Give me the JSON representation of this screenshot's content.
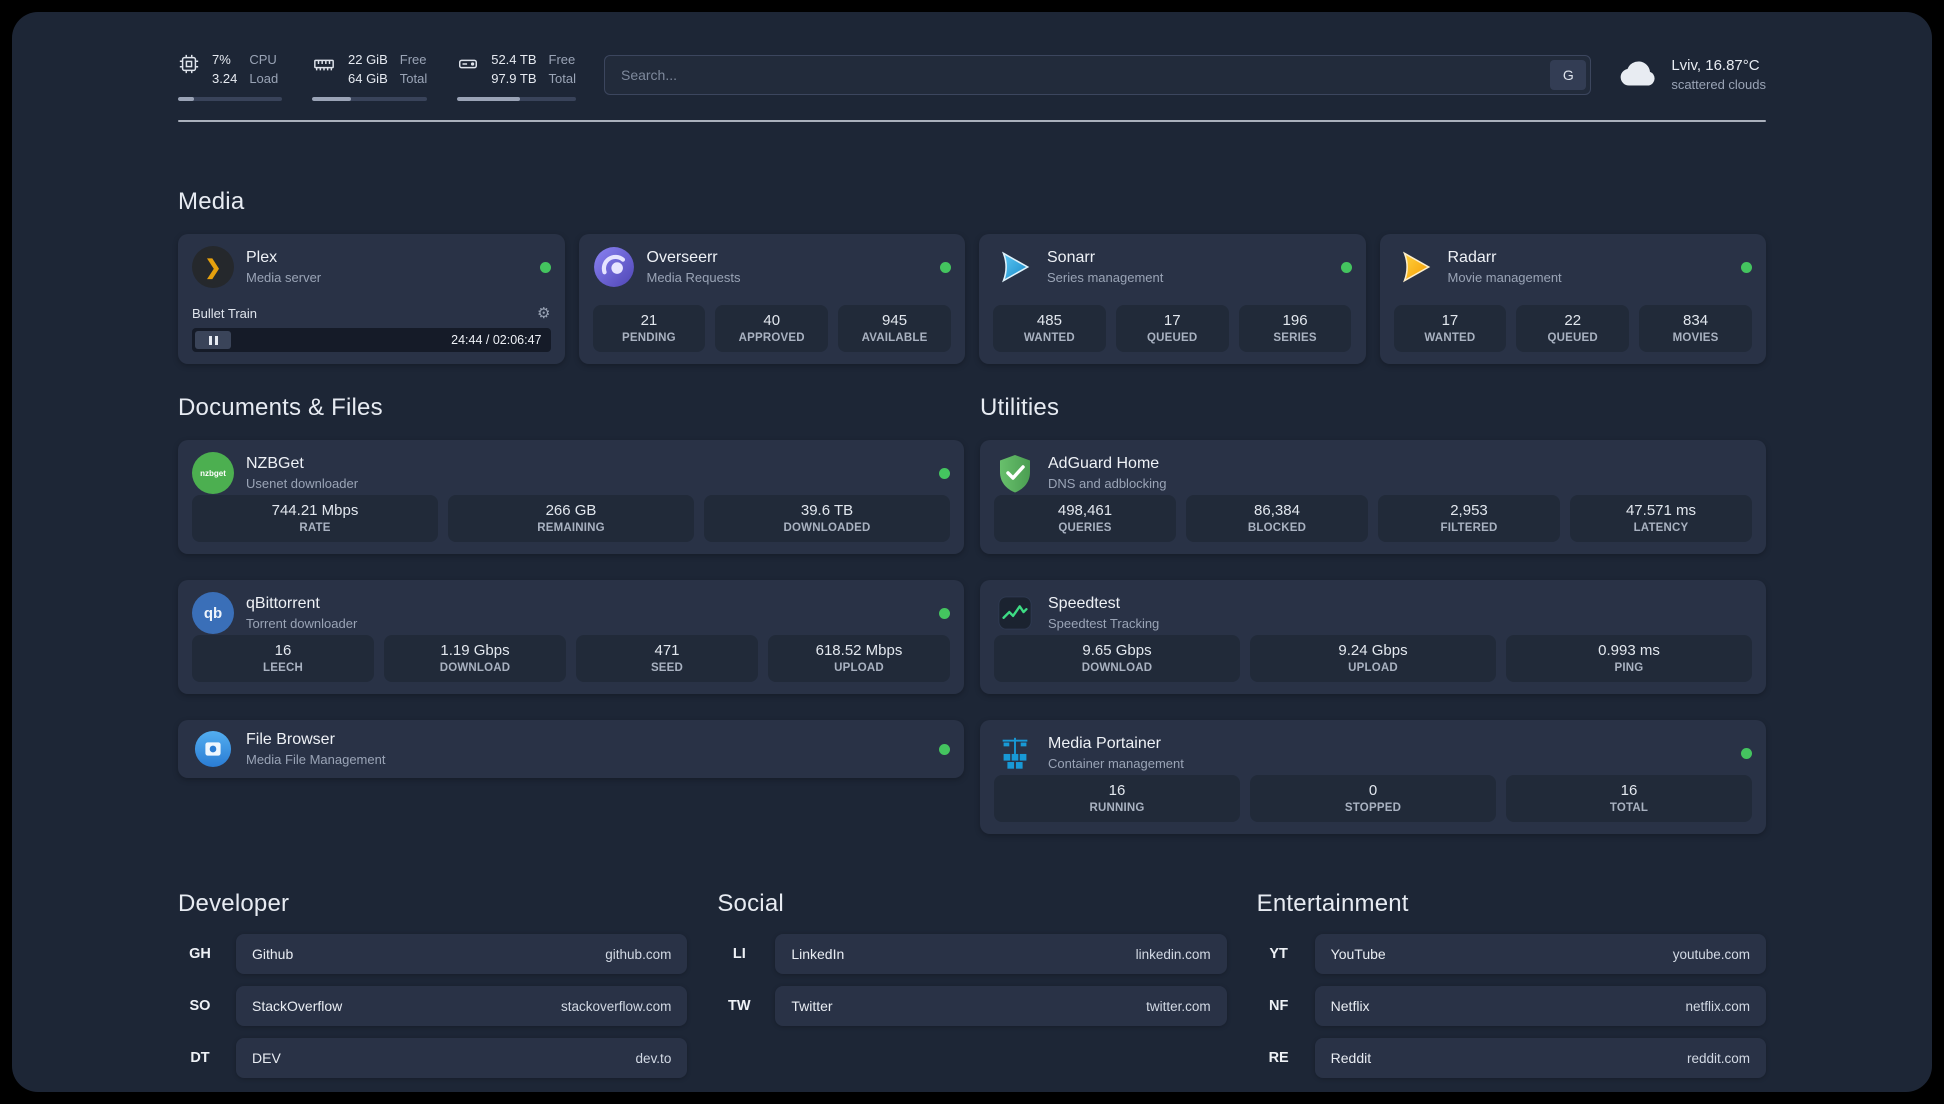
{
  "theme": {
    "page_bg": "#1d2636",
    "card_bg": "#293246",
    "tile_bg": "#212a39",
    "status_green": "#44c45f",
    "plex_amber": "#e5a00d"
  },
  "icons": {
    "gear": "⚙",
    "plex_chevron": "❯"
  },
  "topbar": {
    "cpu": {
      "value": "7%",
      "value2": "3.24",
      "label": "CPU",
      "label2": "Load",
      "progress": 15
    },
    "ram": {
      "value": "22 GiB",
      "value2": "64 GiB",
      "label": "Free",
      "label2": "Total",
      "progress": 34
    },
    "disk": {
      "value": "52.4 TB",
      "value2": "97.9 TB",
      "label": "Free",
      "label2": "Total",
      "progress": 53
    },
    "search": {
      "placeholder": "Search...",
      "button_label": "G"
    },
    "weather": {
      "location": "Lviv, 16.87°C",
      "condition": "scattered clouds"
    }
  },
  "sections": {
    "media": "Media",
    "documents": "Documents & Files",
    "utilities": "Utilities",
    "developer": "Developer",
    "social": "Social",
    "entertainment": "Entertainment"
  },
  "apps": {
    "plex": {
      "title": "Plex",
      "subtitle": "Media server",
      "now_playing": "Bullet Train",
      "time": "24:44 / 02:06:47"
    },
    "overseerr": {
      "title": "Overseerr",
      "subtitle": "Media Requests",
      "stats": [
        {
          "value": "21",
          "label": "PENDING"
        },
        {
          "value": "40",
          "label": "APPROVED"
        },
        {
          "value": "945",
          "label": "AVAILABLE"
        }
      ]
    },
    "sonarr": {
      "title": "Sonarr",
      "subtitle": "Series management",
      "stats": [
        {
          "value": "485",
          "label": "WANTED"
        },
        {
          "value": "17",
          "label": "QUEUED"
        },
        {
          "value": "196",
          "label": "SERIES"
        }
      ]
    },
    "radarr": {
      "title": "Radarr",
      "subtitle": "Movie management",
      "stats": [
        {
          "value": "17",
          "label": "WANTED"
        },
        {
          "value": "22",
          "label": "QUEUED"
        },
        {
          "value": "834",
          "label": "MOVIES"
        }
      ]
    },
    "nzbget": {
      "title": "NZBGet",
      "subtitle": "Usenet downloader",
      "icon_text": "nzbget",
      "stats": [
        {
          "value": "744.21 Mbps",
          "label": "RATE"
        },
        {
          "value": "266 GB",
          "label": "REMAINING"
        },
        {
          "value": "39.6 TB",
          "label": "DOWNLOADED"
        }
      ]
    },
    "qbittorrent": {
      "title": "qBittorrent",
      "subtitle": "Torrent downloader",
      "icon_text": "qb",
      "stats": [
        {
          "value": "16",
          "label": "LEECH"
        },
        {
          "value": "1.19 Gbps",
          "label": "DOWNLOAD"
        },
        {
          "value": "471",
          "label": "SEED"
        },
        {
          "value": "618.52 Mbps",
          "label": "UPLOAD"
        }
      ]
    },
    "filebrowser": {
      "title": "File Browser",
      "subtitle": "Media File Management"
    },
    "adguard": {
      "title": "AdGuard Home",
      "subtitle": "DNS and adblocking",
      "stats": [
        {
          "value": "498,461",
          "label": "QUERIES"
        },
        {
          "value": "86,384",
          "label": "BLOCKED"
        },
        {
          "value": "2,953",
          "label": "FILTERED"
        },
        {
          "value": "47.571 ms",
          "label": "LATENCY"
        }
      ]
    },
    "speedtest": {
      "title": "Speedtest",
      "subtitle": "Speedtest Tracking",
      "stats": [
        {
          "value": "9.65 Gbps",
          "label": "DOWNLOAD"
        },
        {
          "value": "9.24 Gbps",
          "label": "UPLOAD"
        },
        {
          "value": "0.993 ms",
          "label": "PING"
        }
      ]
    },
    "portainer": {
      "title": "Media Portainer",
      "subtitle": "Container management",
      "stats": [
        {
          "value": "16",
          "label": "RUNNING"
        },
        {
          "value": "0",
          "label": "STOPPED"
        },
        {
          "value": "16",
          "label": "TOTAL"
        }
      ]
    }
  },
  "bookmarks": {
    "developer": [
      {
        "abbr": "GH",
        "name": "Github",
        "url": "github.com"
      },
      {
        "abbr": "SO",
        "name": "StackOverflow",
        "url": "stackoverflow.com"
      },
      {
        "abbr": "DT",
        "name": "DEV",
        "url": "dev.to"
      }
    ],
    "social": [
      {
        "abbr": "LI",
        "name": "LinkedIn",
        "url": "linkedin.com"
      },
      {
        "abbr": "TW",
        "name": "Twitter",
        "url": "twitter.com"
      }
    ],
    "entertainment": [
      {
        "abbr": "YT",
        "name": "YouTube",
        "url": "youtube.com"
      },
      {
        "abbr": "NF",
        "name": "Netflix",
        "url": "netflix.com"
      },
      {
        "abbr": "RE",
        "name": "Reddit",
        "url": "reddit.com"
      }
    ]
  }
}
